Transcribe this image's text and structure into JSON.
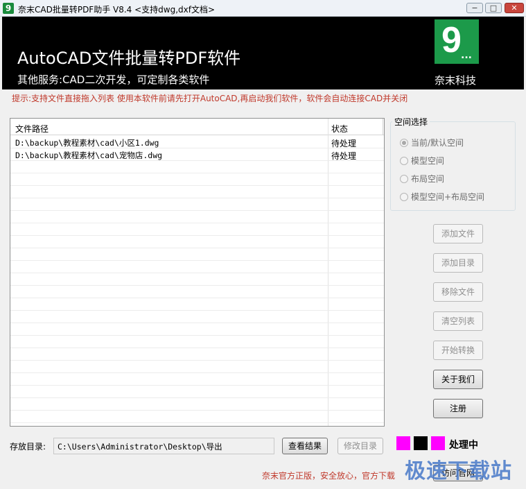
{
  "window": {
    "title": "奈末CAD批量转PDF助手 V8.4  <支持dwg,dxf文档>",
    "icon_glyph": "9",
    "min_glyph": "−",
    "max_glyph": "□",
    "close_glyph": "✕"
  },
  "banner": {
    "title": "AutoCAD文件批量转PDF软件",
    "subtitle": "其他服务:CAD二次开发，可定制各类软件",
    "logo_digit": "9",
    "logo_dots": "...",
    "company": "奈末科技"
  },
  "tip": "提示:支持文件直接拖入列表  使用本软件前请先打开AutoCAD,再启动我们软件，软件会自动连接CAD并关闭",
  "file_list": {
    "columns": [
      "文件路径",
      "状态"
    ],
    "rows": [
      {
        "path": "D:\\backup\\教程素材\\cad\\小区1.dwg",
        "status": "待处理"
      },
      {
        "path": "D:\\backup\\教程素材\\cad\\宠物店.dwg",
        "status": "待处理"
      }
    ]
  },
  "space": {
    "title": "空间选择",
    "options": [
      "当前/默认空间",
      "模型空间",
      "布局空间",
      "模型空间+布局空间"
    ],
    "selected": "当前/默认空间"
  },
  "actions": {
    "add_file": "添加文件",
    "add_dir": "添加目录",
    "remove_file": "移除文件",
    "clear_list": "清空列表",
    "start": "开始转换",
    "about": "关于我们",
    "register": "注册"
  },
  "output": {
    "label": "存放目录:",
    "path": "C:\\Users\\Administrator\\Desktop\\导出",
    "view_button": "查看结果",
    "change_button": "修改目录"
  },
  "status": {
    "text": "处理中",
    "swatch_colors": [
      "#ff00ff",
      "#000000",
      "#ff00ff"
    ]
  },
  "footer": {
    "text": "奈末官方正版，安全放心，官方下载",
    "visit_button": "访问官网",
    "watermark": "极速下载站"
  }
}
